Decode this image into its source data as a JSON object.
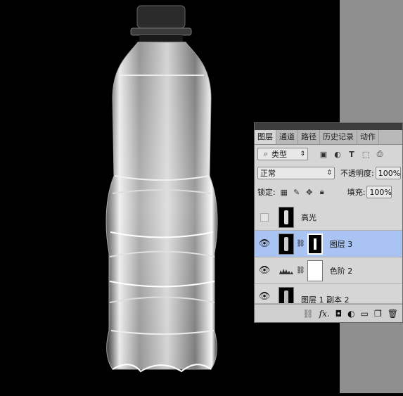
{
  "panel": {
    "tabs": [
      {
        "label": "图层",
        "active": true
      },
      {
        "label": "通道",
        "active": false
      },
      {
        "label": "路径",
        "active": false
      },
      {
        "label": "历史记录",
        "active": false
      },
      {
        "label": "动作",
        "active": false
      }
    ],
    "filter_kind": "类型",
    "blend_mode": "正常",
    "opacity_label": "不透明度:",
    "opacity_value": "100%",
    "lock_label": "锁定:",
    "fill_label": "填充:",
    "fill_value": "100%",
    "layers": [
      {
        "name": "高光",
        "visible": false,
        "selected": false,
        "has_mask": false,
        "type": "pixel"
      },
      {
        "name": "图层 3",
        "visible": true,
        "selected": true,
        "has_mask": true,
        "type": "pixel"
      },
      {
        "name": "色阶 2",
        "visible": true,
        "selected": false,
        "has_mask": true,
        "type": "levels"
      },
      {
        "name": "图层 1 副本 2",
        "visible": true,
        "selected": false,
        "has_mask": false,
        "type": "pixel"
      }
    ],
    "footer_icons": [
      "link-icon",
      "fx-icon",
      "add-mask-icon",
      "adjustment-icon",
      "folder-icon",
      "new-layer-icon",
      "trash-icon"
    ]
  },
  "colors": {
    "selected_row": "#a9c4f2",
    "panel_bg": "#d6d6d6",
    "canvas_bg": "#000000"
  }
}
